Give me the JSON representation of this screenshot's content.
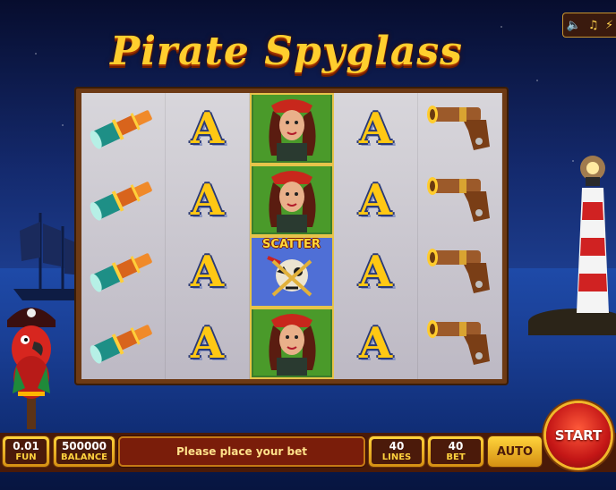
{
  "game": {
    "title": "Pirate Spyglass"
  },
  "sound_panel": {
    "icons": [
      "speaker-icon",
      "music-icon",
      "lightning-icon"
    ]
  },
  "reels": [
    [
      "spyglass",
      "spyglass",
      "spyglass",
      "spyglass"
    ],
    [
      "letter-a",
      "letter-a",
      "letter-a",
      "letter-a"
    ],
    [
      "pirate-woman",
      "pirate-woman",
      "scatter",
      "pirate-woman"
    ],
    [
      "letter-a",
      "letter-a",
      "letter-a",
      "letter-a"
    ],
    [
      "pistol",
      "pistol",
      "pistol",
      "pistol"
    ]
  ],
  "symbols": {
    "letter_a": "A",
    "scatter_label": "SCATTER"
  },
  "controls": {
    "coin_value": "0.01",
    "coin_label": "FUN",
    "balance_value": "500000",
    "balance_label": "BALANCE",
    "message": "Please place your bet",
    "lines_value": "40",
    "lines_label": "LINES",
    "bet_value": "40",
    "bet_label": "BET",
    "auto_label": "AUTO",
    "start_label": "START"
  },
  "colors": {
    "title_gold": "#ffce2e",
    "frame_brown": "#6d3a14",
    "button_gold": "#ffd43c",
    "start_red": "#c41616"
  }
}
